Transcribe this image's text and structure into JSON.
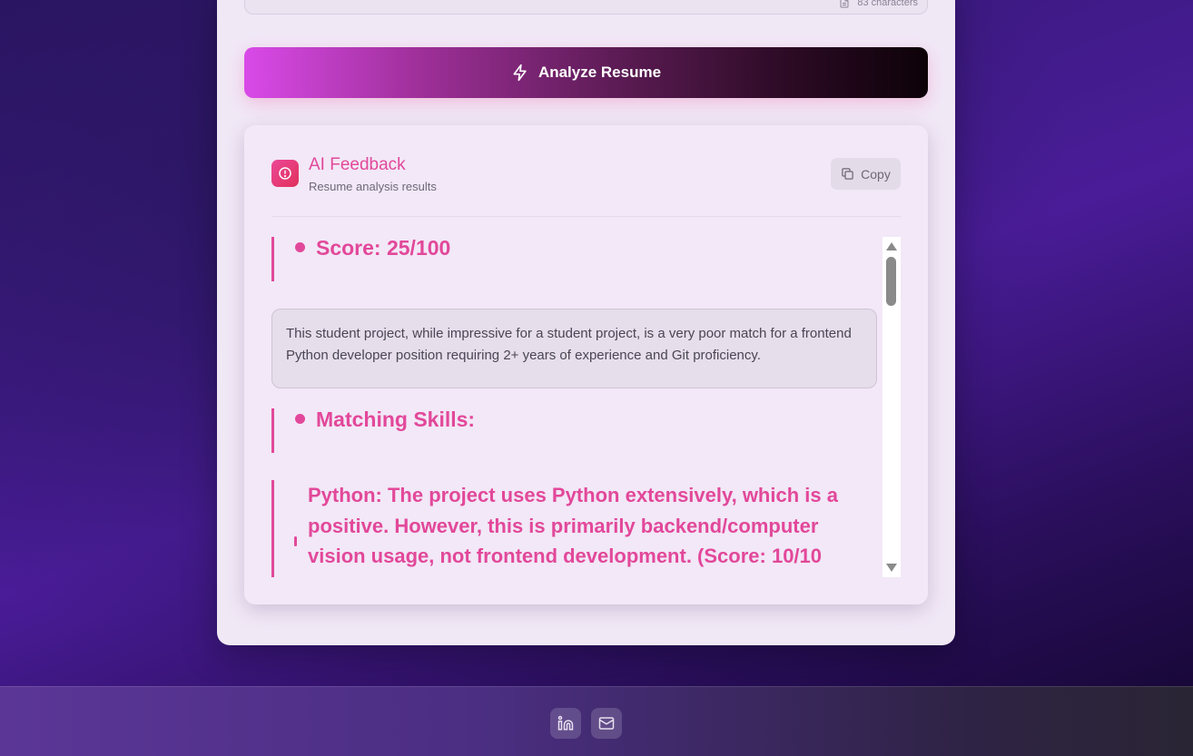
{
  "input": {
    "char_count": "83 characters"
  },
  "analyze_button": {
    "label": "Analyze Resume"
  },
  "feedback": {
    "title": "AI Feedback",
    "subtitle": "Resume analysis results",
    "copy_label": "Copy",
    "score_heading": "Score: 25/100",
    "summary": "This student project, while impressive for a student project, is a very poor match for a frontend Python developer position requiring 2+ years of experience and Git proficiency.",
    "matching_heading": "Matching Skills:",
    "skill_item": "Python: The project uses Python extensively, which is a positive. However, this is primarily backend/computer vision usage, not frontend development. (Score: 10/10"
  },
  "footer": {
    "icons": [
      "linkedin-icon",
      "mail-icon"
    ]
  },
  "colors": {
    "accent": "#e2489a",
    "card_bg": "#f1e8f6",
    "page_bg": "#3b1a80"
  }
}
